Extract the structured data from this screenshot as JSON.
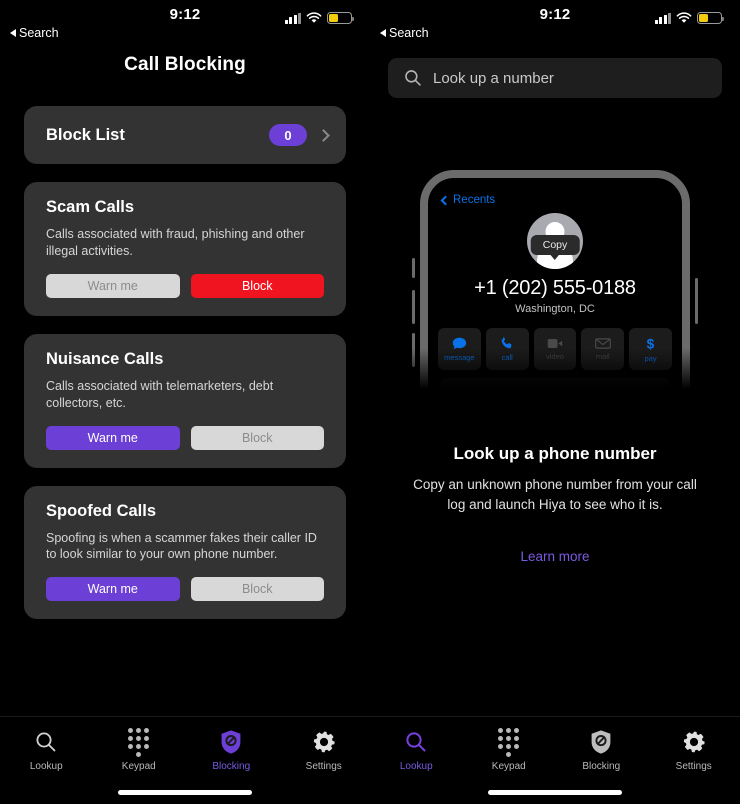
{
  "status_bar": {
    "time": "9:12",
    "back_label": "Search",
    "signal_icon": "cellular-bars-icon",
    "wifi_icon": "wifi-icon",
    "battery_icon": "battery-low-power-icon",
    "battery_color": "#f2cc0d"
  },
  "theme": {
    "background": "#000000",
    "card": "#333333",
    "accent_purple": "#6C3FD6",
    "link_purple": "#7a5ae0",
    "danger_red": "#f01421",
    "inactive_gray": "#d8d8d8",
    "inactive_text": "#8c8c8c",
    "ios_blue": "#0a72e8"
  },
  "left_screen": {
    "title": "Call Blocking",
    "block_list": {
      "label": "Block List",
      "count": "0",
      "chevron_icon": "chevron-right-icon"
    },
    "categories": [
      {
        "title": "Scam Calls",
        "description": "Calls associated with fraud, phishing and other illegal activities.",
        "buttons": [
          {
            "label": "Warn me",
            "state": "inactive"
          },
          {
            "label": "Block",
            "state": "active-red"
          }
        ]
      },
      {
        "title": "Nuisance Calls",
        "description": "Calls associated with telemarketers, debt collectors, etc.",
        "buttons": [
          {
            "label": "Warn me",
            "state": "active-purple"
          },
          {
            "label": "Block",
            "state": "inactive"
          }
        ]
      },
      {
        "title": "Spoofed Calls",
        "description": "Spoofing is when a scammer fakes their caller ID to look similar to your own phone number.",
        "buttons": [
          {
            "label": "Warn me",
            "state": "active-purple"
          },
          {
            "label": "Block",
            "state": "inactive"
          }
        ]
      }
    ],
    "tabs": [
      {
        "label": "Lookup",
        "icon": "search-icon",
        "active": false
      },
      {
        "label": "Keypad",
        "icon": "keypad-icon",
        "active": false
      },
      {
        "label": "Blocking",
        "icon": "shield-block-icon",
        "active": true
      },
      {
        "label": "Settings",
        "icon": "gear-icon",
        "active": false
      }
    ]
  },
  "right_screen": {
    "search": {
      "icon": "search-icon",
      "placeholder": "Look up a number",
      "value": ""
    },
    "phone_mockup": {
      "back_label": "Recents",
      "back_icon": "chevron-left-icon",
      "avatar_icon": "person-avatar-icon",
      "tooltip": "Copy",
      "number": "+1 (202) 555-0188",
      "location": "Washington, DC",
      "actions": [
        {
          "label": "message",
          "icon": "message-bubble-icon",
          "enabled": true
        },
        {
          "label": "call",
          "icon": "phone-handset-icon",
          "enabled": true
        },
        {
          "label": "video",
          "icon": "video-camera-icon",
          "enabled": false
        },
        {
          "label": "mail",
          "icon": "envelope-icon",
          "enabled": false
        },
        {
          "label": "pay",
          "icon": "dollar-sign-icon",
          "enabled": true
        }
      ]
    },
    "empty_state": {
      "title": "Look up a phone number",
      "description": "Copy an unknown phone number from your call log and launch Hiya to see who it is.",
      "link": "Learn more"
    },
    "tabs": [
      {
        "label": "Lookup",
        "icon": "search-icon",
        "active": true
      },
      {
        "label": "Keypad",
        "icon": "keypad-icon",
        "active": false
      },
      {
        "label": "Blocking",
        "icon": "shield-block-icon",
        "active": false
      },
      {
        "label": "Settings",
        "icon": "gear-icon",
        "active": false
      }
    ]
  }
}
